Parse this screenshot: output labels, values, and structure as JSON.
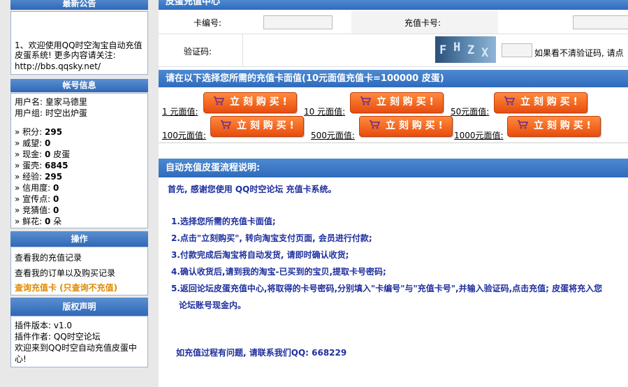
{
  "sidebar": {
    "notice_header": "最新公告",
    "notice_text_1": "1、欢迎使用QQ时空淘宝自动充值",
    "notice_text_2": "皮蛋系统! 更多内容请关注:",
    "notice_text_3": "http://bbs.qqsky.net/",
    "account_header": "帐号信息",
    "username_line": "用户名: 皇家马德里",
    "group_line": "用户组: 时空出炉蛋",
    "stats": [
      {
        "label": "» 积分: ",
        "value": "295"
      },
      {
        "label": "» 威望: ",
        "value": "0"
      },
      {
        "label": "» 现金: ",
        "value": "0",
        "suffix": " 皮蛋"
      },
      {
        "label": "» 蛋壳: ",
        "value": "6845"
      },
      {
        "label": "» 经验: ",
        "value": "295"
      },
      {
        "label": "» 信用度: ",
        "value": "0"
      },
      {
        "label": "» 宣传点: ",
        "value": "0"
      },
      {
        "label": "» 竞猜值: ",
        "value": "0"
      },
      {
        "label": "» 鲜花: ",
        "value": "0",
        "suffix": " 朵"
      }
    ],
    "ops_header": "操作",
    "ops": [
      "查看我的充值记录",
      "查看我的订单以及购买记录",
      "查询充值卡 (只查询不充值)"
    ],
    "copyright_header": "版权声明",
    "plugin_version": "插件版本:   v1.0",
    "plugin_author": "插件作者:    QQ时空论坛",
    "welcome_1": "欢迎来到QQ时空自动充值皮蛋中",
    "welcome_2": "心!"
  },
  "main": {
    "top_title": "皮蛋充值中心",
    "card_no_label": "卡编号:",
    "card_pwd_label": "充值卡号:",
    "captcha_label": "验证码:",
    "captcha_chars": [
      "F",
      "H",
      "Z",
      "X"
    ],
    "captcha_hint": "如果看不清验证码, 请点",
    "select_title": "请在以下选择您所需的充值卡面值(10元面值充值卡=100000 皮蛋)",
    "buy_label": "立 刻 购 买 !",
    "denoms": [
      "1 元面值:",
      "10 元面值:",
      "50元面值:",
      "100元面值:",
      "500元面值:",
      "1000元面值:"
    ],
    "flow_title": "自动充值皮蛋流程说明:",
    "intro": "首先, 感谢您使用  QQ时空论坛  充值卡系统。",
    "steps": [
      "1.选择您所需的充值卡面值;",
      "2.点击\"立刻购买\", 转向淘宝支付页面, 会员进行付款;",
      "3.付款完成后淘宝将自动发货, 请即时确认收货;",
      "4.确认收货后,请到我的淘宝-已买到的宝贝,提取卡号密码;",
      "5.返回论坛皮蛋充值中心,将取得的卡号密码,分别填入\"卡编号\"与\"充值卡号\",并输入验证码,点击充值; 皮蛋将充入您",
      "论坛账号现金内。"
    ],
    "contact": "如充值过程有问题, 请联系我们QQ: 668229"
  },
  "colors": {
    "header_blue": "#2f68b8",
    "button_orange": "#e84d0e",
    "step_text": "#1e2f9e",
    "link_orange": "#e08a00"
  }
}
